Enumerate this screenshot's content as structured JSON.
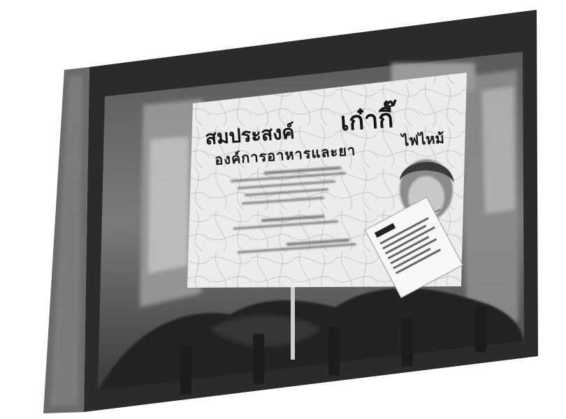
{
  "poster": {
    "title_left": "สมประสงค์",
    "title_right": "เก๋ากี๊",
    "subtitle": "องค์การอาหารและยา",
    "subtitle_right": "ไฟไหม้"
  },
  "colors": {
    "frame": "#2a2a2a",
    "poster": "#eeeeee",
    "background": "#ffffff"
  }
}
